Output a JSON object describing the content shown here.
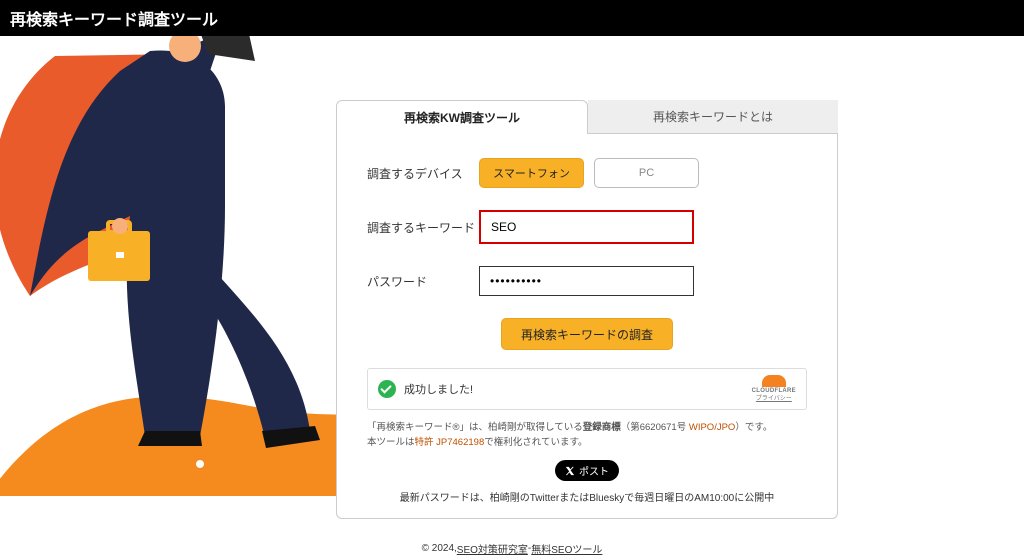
{
  "header": {
    "title": "再検索キーワード調査ツール"
  },
  "tabs": {
    "active": "再検索KW調査ツール",
    "inactive": "再検索キーワードとは"
  },
  "form": {
    "device_label": "調査するデバイス",
    "device_sp": "スマートフォン",
    "device_pc": "PC",
    "keyword_label": "調査するキーワード",
    "keyword_value": "SEO",
    "password_label": "パスワード",
    "password_value": "••••••••••",
    "submit": "再検索キーワードの調査"
  },
  "captcha": {
    "success": "成功しました!",
    "brand": "CLOUDFLARE",
    "sub": "プライバシー"
  },
  "fine": {
    "line1_a": "「再検索キーワード®」は、柏崎剛が取得している",
    "line1_b": "登録商標",
    "line1_c": "（第6620671号 ",
    "line1_link": "WIPO/JPO",
    "line1_d": "）です。",
    "line2_a": "本ツールは",
    "line2_link": "特許 JP7462198",
    "line2_b": "で権利化されています。"
  },
  "post": {
    "label": "ポスト"
  },
  "cutline": "最新パスワードは、柏崎剛のTwitterまたはBlueskyで毎週日曜日のAM10:00に公開中",
  "footer": {
    "copyright": "© 2024, ",
    "link1": "SEO対策研究室",
    "sep": " - ",
    "link2": "無料SEOツール"
  }
}
